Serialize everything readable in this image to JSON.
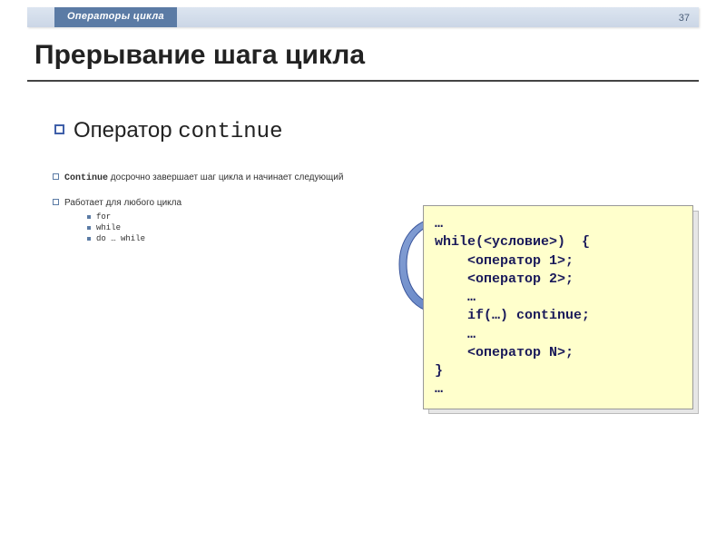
{
  "header": {
    "section_title": "Операторы цикла",
    "page_number": "37"
  },
  "title": "Прерывание шага цикла",
  "subtitle": {
    "prefix": "Оператор ",
    "keyword": "continue"
  },
  "desc1": {
    "keyword": "Continue",
    "rest": " досрочно завершает шаг цикла и начинает следующий"
  },
  "desc2": "Работает для любого цикла",
  "loop_types": [
    "for",
    "while",
    "do … while"
  ],
  "code": "…\nwhile(<условие>)  {\n    <оператор 1>;\n    <оператор 2>;\n    …\n    if(…) continue;\n    …\n    <оператор N>;\n}\n…"
}
